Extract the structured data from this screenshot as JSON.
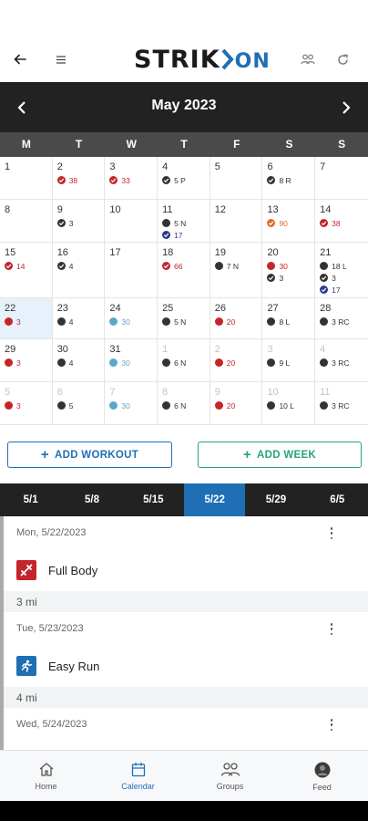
{
  "app": {
    "logo_main": "STRIK",
    "logo_accent": "ON"
  },
  "colors": {
    "accent": "#1f6fb5",
    "teal": "#27a37a",
    "red": "#c4252b",
    "orange": "#e46b27",
    "navy": "#2a3a8f",
    "light_blue": "#5aa8c8"
  },
  "calendar": {
    "month": "May 2023",
    "weekdays": [
      "M",
      "T",
      "W",
      "T",
      "F",
      "S",
      "S"
    ],
    "weeks": [
      [
        {
          "day": "1",
          "items": []
        },
        {
          "day": "2",
          "items": [
            {
              "status": "check",
              "color": "red",
              "text": "38"
            }
          ]
        },
        {
          "day": "3",
          "items": [
            {
              "status": "check",
              "color": "red",
              "text": "33"
            }
          ]
        },
        {
          "day": "4",
          "items": [
            {
              "status": "check",
              "color": "blue",
              "text": "5 P"
            }
          ]
        },
        {
          "day": "5",
          "items": []
        },
        {
          "day": "6",
          "items": [
            {
              "status": "check",
              "color": "blue",
              "text": "8 R"
            }
          ]
        },
        {
          "day": "7",
          "items": []
        }
      ],
      [
        {
          "day": "8",
          "items": []
        },
        {
          "day": "9",
          "items": [
            {
              "status": "check",
              "color": "blue",
              "text": "3"
            }
          ]
        },
        {
          "day": "10",
          "items": []
        },
        {
          "day": "11",
          "items": [
            {
              "status": "dot",
              "color": "blue",
              "text": "5 N"
            },
            {
              "status": "check",
              "color": "navy",
              "text": "17"
            }
          ]
        },
        {
          "day": "12",
          "items": []
        },
        {
          "day": "13",
          "items": [
            {
              "status": "check",
              "color": "orange",
              "text": "90"
            }
          ]
        },
        {
          "day": "14",
          "items": [
            {
              "status": "check",
              "color": "red",
              "text": "38"
            }
          ]
        }
      ],
      [
        {
          "day": "15",
          "items": [
            {
              "status": "check",
              "color": "red",
              "text": "14"
            }
          ]
        },
        {
          "day": "16",
          "items": [
            {
              "status": "check",
              "color": "blue",
              "text": "4"
            }
          ]
        },
        {
          "day": "17",
          "items": []
        },
        {
          "day": "18",
          "items": [
            {
              "status": "check",
              "color": "red",
              "text": "66"
            }
          ]
        },
        {
          "day": "19",
          "items": [
            {
              "status": "dot",
              "color": "blue",
              "text": "7 N"
            }
          ]
        },
        {
          "day": "20",
          "items": [
            {
              "status": "dot",
              "color": "red",
              "text": "30"
            },
            {
              "status": "check",
              "color": "blue",
              "text": "3"
            }
          ]
        },
        {
          "day": "21",
          "items": [
            {
              "status": "dot",
              "color": "blue",
              "text": "18 L"
            },
            {
              "status": "check",
              "color": "blue",
              "text": "3"
            },
            {
              "status": "check",
              "color": "navy",
              "text": "17"
            }
          ]
        }
      ],
      [
        {
          "day": "22",
          "selected": true,
          "items": [
            {
              "status": "dot",
              "color": "red",
              "text": "3"
            }
          ]
        },
        {
          "day": "23",
          "items": [
            {
              "status": "dot",
              "color": "blue",
              "text": "4"
            }
          ]
        },
        {
          "day": "24",
          "items": [
            {
              "status": "dot",
              "color": "light_blue",
              "text": "30"
            }
          ]
        },
        {
          "day": "25",
          "items": [
            {
              "status": "dot",
              "color": "blue",
              "text": "5 N"
            }
          ]
        },
        {
          "day": "26",
          "items": [
            {
              "status": "dot",
              "color": "red",
              "text": "20"
            }
          ]
        },
        {
          "day": "27",
          "items": [
            {
              "status": "dot",
              "color": "blue",
              "text": "8 L"
            }
          ]
        },
        {
          "day": "28",
          "items": [
            {
              "status": "dot",
              "color": "blue",
              "text": "3 RC"
            }
          ]
        }
      ],
      [
        {
          "day": "29",
          "items": [
            {
              "status": "dot",
              "color": "red",
              "text": "3"
            }
          ]
        },
        {
          "day": "30",
          "items": [
            {
              "status": "dot",
              "color": "blue",
              "text": "4"
            }
          ]
        },
        {
          "day": "31",
          "items": [
            {
              "status": "dot",
              "color": "light_blue",
              "text": "30"
            }
          ]
        },
        {
          "day": "1",
          "dim": true,
          "items": [
            {
              "status": "dot",
              "color": "blue",
              "text": "6 N"
            }
          ]
        },
        {
          "day": "2",
          "dim": true,
          "items": [
            {
              "status": "dot",
              "color": "red",
              "text": "20"
            }
          ]
        },
        {
          "day": "3",
          "dim": true,
          "items": [
            {
              "status": "dot",
              "color": "blue",
              "text": "9 L"
            }
          ]
        },
        {
          "day": "4",
          "dim": true,
          "items": [
            {
              "status": "dot",
              "color": "blue",
              "text": "3 RC"
            }
          ]
        }
      ],
      [
        {
          "day": "5",
          "dim": true,
          "items": [
            {
              "status": "dot",
              "color": "red",
              "text": "3"
            }
          ]
        },
        {
          "day": "6",
          "dim": true,
          "items": [
            {
              "status": "dot",
              "color": "blue",
              "text": "5"
            }
          ]
        },
        {
          "day": "7",
          "dim": true,
          "items": [
            {
              "status": "dot",
              "color": "light_blue",
              "text": "30"
            }
          ]
        },
        {
          "day": "8",
          "dim": true,
          "items": [
            {
              "status": "dot",
              "color": "blue",
              "text": "6 N"
            }
          ]
        },
        {
          "day": "9",
          "dim": true,
          "items": [
            {
              "status": "dot",
              "color": "red",
              "text": "20"
            }
          ]
        },
        {
          "day": "10",
          "dim": true,
          "items": [
            {
              "status": "dot",
              "color": "blue",
              "text": "10 L"
            }
          ]
        },
        {
          "day": "11",
          "dim": true,
          "items": [
            {
              "status": "dot",
              "color": "blue",
              "text": "3 RC"
            }
          ]
        }
      ]
    ]
  },
  "actions": {
    "add_workout": "ADD WORKOUT",
    "add_week": "ADD WEEK"
  },
  "week_tabs": [
    {
      "label": "5/1",
      "active": false
    },
    {
      "label": "5/8",
      "active": false
    },
    {
      "label": "5/15",
      "active": false
    },
    {
      "label": "5/22",
      "active": true
    },
    {
      "label": "5/29",
      "active": false
    },
    {
      "label": "6/5",
      "active": false
    }
  ],
  "feed": [
    {
      "date": "Mon, 5/22/2023",
      "workout": "Full Body",
      "icon": "strength-icon",
      "color": "red",
      "summary": "3 mi"
    },
    {
      "date": "Tue, 5/23/2023",
      "workout": "Easy Run",
      "icon": "runner-icon",
      "color": "blue",
      "summary": "4 mi"
    },
    {
      "date": "Wed, 5/24/2023",
      "workout": "",
      "icon": "workout-icon",
      "color": "light_blue",
      "summary": ""
    }
  ],
  "bottom_nav": [
    {
      "label": "Home",
      "icon": "home-icon",
      "active": false
    },
    {
      "label": "Calendar",
      "icon": "calendar-icon",
      "active": true
    },
    {
      "label": "Groups",
      "icon": "groups-icon",
      "active": false
    },
    {
      "label": "Feed",
      "icon": "avatar",
      "active": false
    }
  ]
}
